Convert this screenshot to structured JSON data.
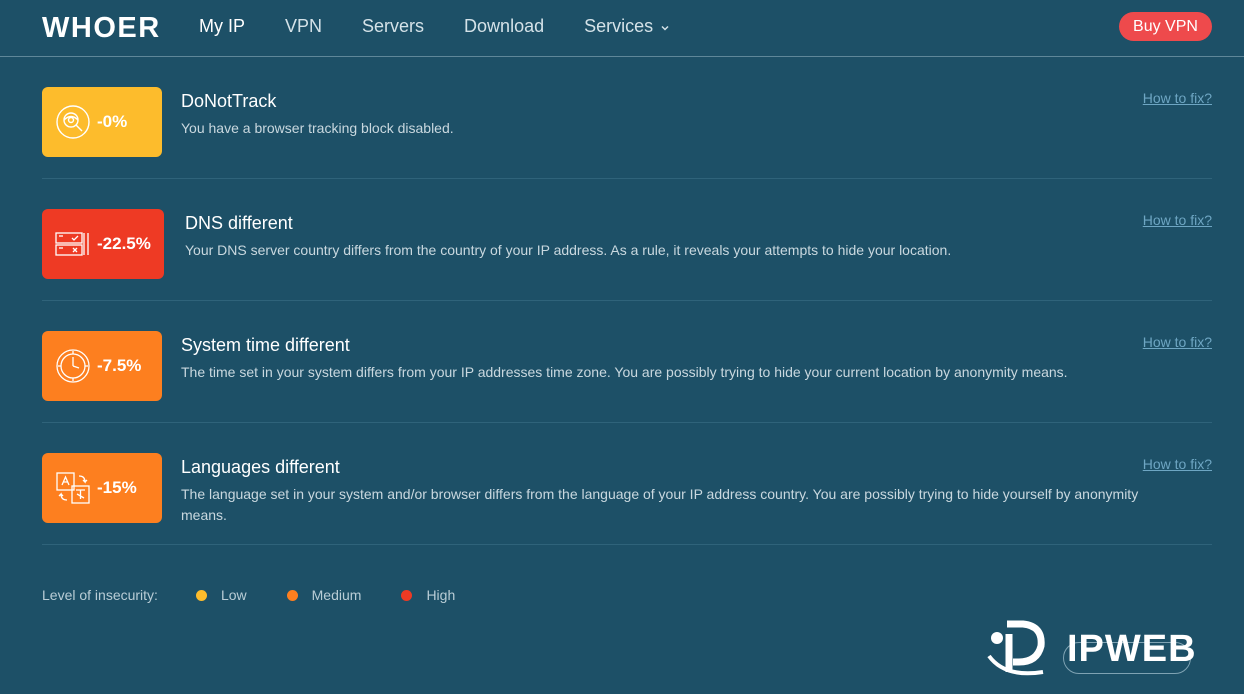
{
  "header": {
    "logo": "WHOER",
    "nav": [
      "My IP",
      "VPN",
      "Servers",
      "Download",
      "Services"
    ],
    "buy_label": "Buy VPN"
  },
  "rows": [
    {
      "icon": "eye-search-icon",
      "percent": "-0%",
      "title": "DoNotTrack",
      "description": "You have a browser tracking block disabled.",
      "fix": "How to fix?",
      "color": "#fdbc2c"
    },
    {
      "icon": "server-icon",
      "percent": "-22.5%",
      "title": "DNS different",
      "description": "Your DNS server country differs from the country of your IP address. As a rule, it reveals your attempts to hide your location.",
      "fix": "How to fix?",
      "color": "#ee3a24"
    },
    {
      "icon": "clock-icon",
      "percent": "-7.5%",
      "title": "System time different",
      "description": "The time set in your system differs from your IP addresses time zone. You are possibly trying to hide your current location by anonymity means.",
      "fix": "How to fix?",
      "color": "#fd7f1f"
    },
    {
      "icon": "language-icon",
      "percent": "-15%",
      "title": "Languages different",
      "description": "The language set in your system and/or browser differs from the language of your IP address country. You are possibly trying to hide yourself by anonymity means.",
      "fix": "How to fix?",
      "color": "#fd7f1f"
    }
  ],
  "legend": {
    "label": "Level of insecurity:",
    "items": [
      {
        "label": "Low",
        "color": "#fdbc2c"
      },
      {
        "label": "Medium",
        "color": "#fd7f1f"
      },
      {
        "label": "High",
        "color": "#ee3a24"
      }
    ]
  },
  "watermark": {
    "text": "IPWEB"
  },
  "colors": {
    "background": "#1d5067",
    "accent": "#ee4a4c",
    "link": "#6ea6c3"
  }
}
